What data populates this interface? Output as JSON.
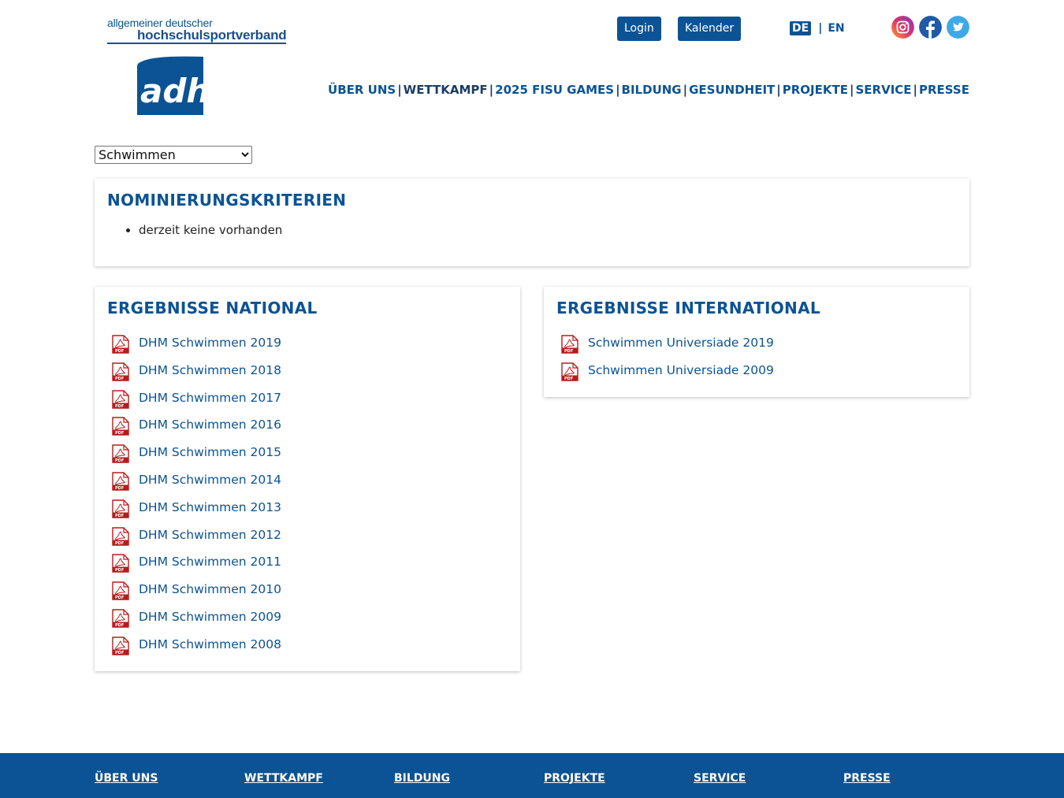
{
  "header": {
    "logo_line1": "allgemeiner deutscher",
    "logo_line2": "hochschulsportverband",
    "logo_mark": "adh",
    "login_label": "Login",
    "kalender_label": "Kalender",
    "lang_de": "DE",
    "lang_sep": "|",
    "lang_en": "EN",
    "social": [
      "instagram-icon",
      "facebook-icon",
      "twitter-icon"
    ]
  },
  "nav": {
    "items": [
      {
        "label": "ÜBER UNS"
      },
      {
        "label": "WETTKAMPF"
      },
      {
        "label": "2025 FISU GAMES"
      },
      {
        "label": "BILDUNG"
      },
      {
        "label": "GESUNDHEIT"
      },
      {
        "label": "PROJEKTE"
      },
      {
        "label": "SERVICE"
      },
      {
        "label": "PRESSE"
      }
    ],
    "separator": "|"
  },
  "sport_select": {
    "selected": "Schwimmen"
  },
  "nominierung": {
    "title": "NOMINIERUNGSKRITERIEN",
    "items": [
      "derzeit keine vorhanden"
    ]
  },
  "national": {
    "title": "ERGEBNISSE NATIONAL",
    "files": [
      "DHM Schwimmen 2019",
      "DHM Schwimmen 2018",
      "DHM Schwimmen 2017",
      "DHM Schwimmen 2016",
      "DHM Schwimmen 2015",
      "DHM Schwimmen 2014",
      "DHM Schwimmen 2013",
      "DHM Schwimmen 2012",
      "DHM Schwimmen 2011",
      "DHM Schwimmen 2010",
      "DHM Schwimmen 2009",
      "DHM Schwimmen 2008"
    ]
  },
  "international": {
    "title": "ERGEBNISSE INTERNATIONAL",
    "files": [
      "Schwimmen Universiade 2019",
      "Schwimmen Universiade 2009"
    ]
  },
  "footer": {
    "columns": [
      "ÜBER UNS",
      "WETTKAMPF",
      "BILDUNG",
      "PROJEKTE",
      "SERVICE",
      "PRESSE"
    ]
  },
  "colors": {
    "brand_blue": "#0b5394",
    "pdf_red": "#b71c1c"
  }
}
